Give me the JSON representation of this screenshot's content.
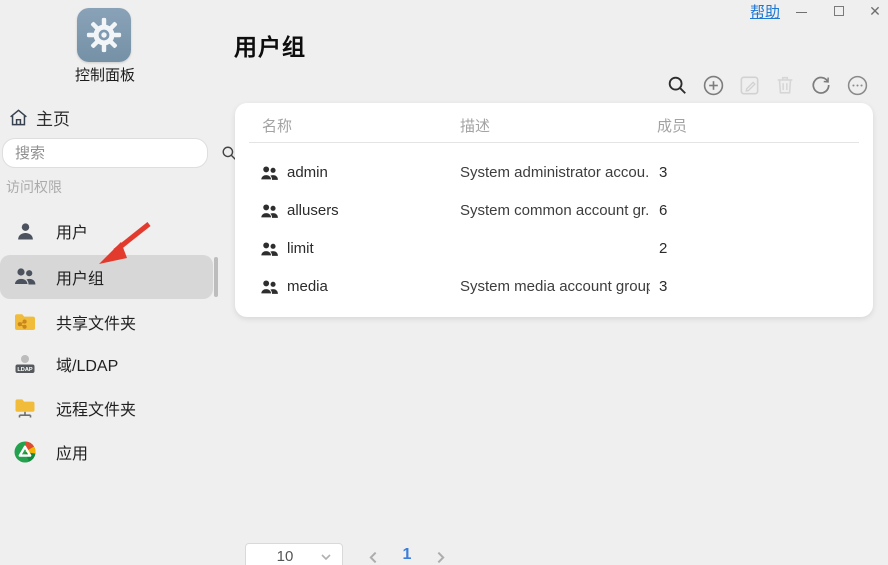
{
  "window": {
    "help_label": "帮助"
  },
  "app": {
    "launcher_label": "控制面板"
  },
  "sidebar": {
    "home_label": "主页",
    "search_placeholder": "搜索",
    "section_label": "访问权限",
    "items": [
      {
        "label": "用户",
        "icon": "user-icon",
        "selected": false
      },
      {
        "label": "用户组",
        "icon": "user-group-icon",
        "selected": true
      },
      {
        "label": "共享文件夹",
        "icon": "shared-folder-icon",
        "selected": false
      },
      {
        "label": "域/LDAP",
        "icon": "ldap-icon",
        "selected": false
      },
      {
        "label": "远程文件夹",
        "icon": "remote-folder-icon",
        "selected": false
      },
      {
        "label": "应用",
        "icon": "apps-icon",
        "selected": false
      }
    ]
  },
  "main": {
    "title": "用户组",
    "toolbar": {
      "icons": [
        "search-icon",
        "add-icon",
        "edit-icon",
        "delete-icon",
        "refresh-icon",
        "more-icon"
      ],
      "disabled": [
        "edit-icon",
        "delete-icon"
      ]
    },
    "table": {
      "columns": {
        "name": "名称",
        "description": "描述",
        "members": "成员"
      },
      "rows": [
        {
          "name": "admin",
          "description": "System administrator accou...",
          "members": "3"
        },
        {
          "name": "allusers",
          "description": "System common account gr...",
          "members": "6"
        },
        {
          "name": "limit",
          "description": "",
          "members": "2"
        },
        {
          "name": "media",
          "description": "System media account group",
          "members": "3"
        }
      ]
    },
    "pagination": {
      "page_size": "10",
      "current_page": "1"
    }
  },
  "colors": {
    "background": "#efefef",
    "card": "#ffffff",
    "selected_item": "#d7d7d7",
    "accent_blue": "#2b7de1",
    "annotation_red": "#e23b2e",
    "folder_yellow": "#f2bc3b",
    "launcher_blue_gray": "#7e99b0"
  }
}
